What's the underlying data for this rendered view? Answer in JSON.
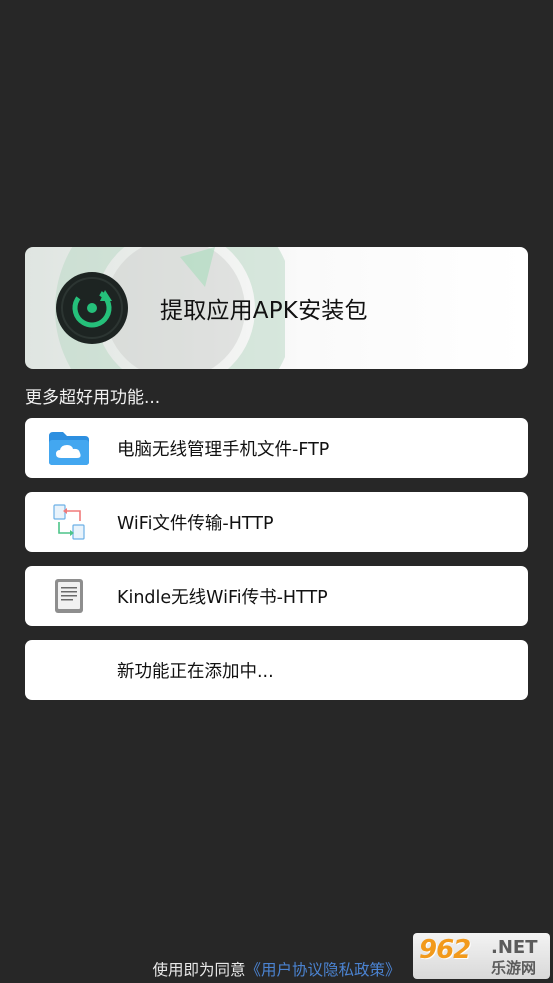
{
  "hero": {
    "label": "提取应用APK安装包",
    "icon": "apk-extract-icon",
    "accent": "#1fae6b"
  },
  "section": {
    "label": "更多超好用功能..."
  },
  "items": [
    {
      "label": "电脑无线管理手机文件-FTP",
      "icon": "cloud-folder-icon"
    },
    {
      "label": "WiFi文件传输-HTTP",
      "icon": "file-transfer-icon"
    },
    {
      "label": "Kindle无线WiFi传书-HTTP",
      "icon": "kindle-icon"
    },
    {
      "label": "新功能正在添加中..."
    }
  ],
  "footer": {
    "prefix": "使用即为同意",
    "link": "《用户协议隐私政策》"
  },
  "watermark": {
    "number": "962",
    "suffix": ".NET",
    "chinese": "乐游网"
  },
  "colors": {
    "background": "#272727",
    "card": "#ffffff",
    "link": "#4b83d1",
    "watermark_orange": "#f29a1c"
  }
}
